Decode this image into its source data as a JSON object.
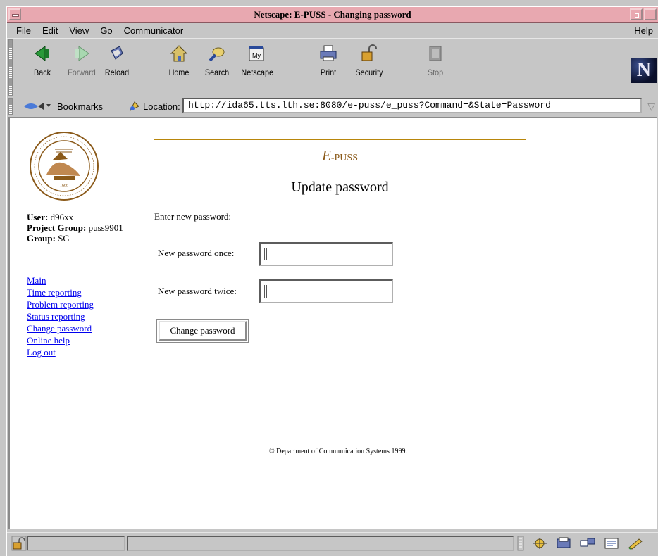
{
  "window": {
    "title": "Netscape: E-PUSS - Changing password"
  },
  "menubar": {
    "items": [
      "File",
      "Edit",
      "View",
      "Go",
      "Communicator"
    ],
    "help": "Help"
  },
  "toolbar": {
    "back": "Back",
    "forward": "Forward",
    "reload": "Reload",
    "home": "Home",
    "search": "Search",
    "netscape": "Netscape",
    "print": "Print",
    "security": "Security",
    "stop": "Stop"
  },
  "locationbar": {
    "bookmarks": "Bookmarks",
    "location_label": "Location:",
    "url": "http://ida65.tts.lth.se:8080/e-puss/e_puss?Command=&State=Password"
  },
  "sidebar": {
    "user_label": "User:",
    "user_value": "d96xx",
    "project_label": "Project Group:",
    "project_value": "puss9901",
    "group_label": "Group:",
    "group_value": "SG",
    "links": [
      "Main",
      "Time reporting",
      "Problem reporting",
      "Status reporting",
      "Change password",
      "Online help",
      "Log out"
    ]
  },
  "header": {
    "brand_e": "E",
    "brand_rest": "-PUSS",
    "title": "Update password"
  },
  "form": {
    "prompt": "Enter new password:",
    "label_once": "New password once:",
    "label_twice": "New password twice:",
    "value_once": "",
    "value_twice": "",
    "submit": "Change password"
  },
  "footer": {
    "text": "© Department of Communication Systems 1999."
  },
  "colors": {
    "titlebar": "#e8a8b0",
    "chrome": "#c6c6c6",
    "brand": "#8b5a1a",
    "link": "#0000ee"
  }
}
